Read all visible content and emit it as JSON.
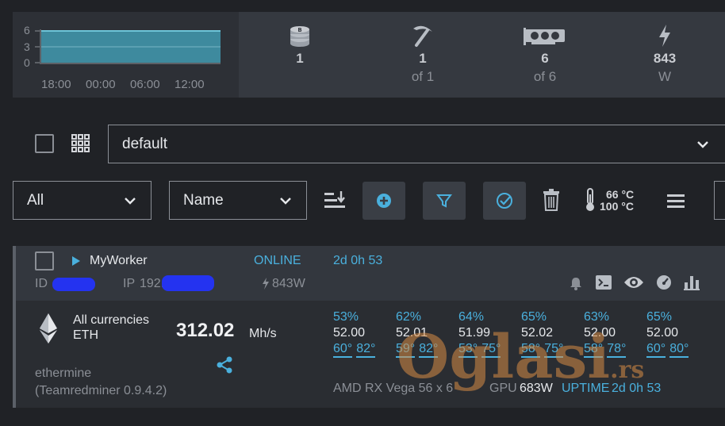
{
  "chart": {
    "y_ticks": [
      "6",
      "3",
      "0"
    ],
    "x_ticks": [
      "18:00",
      "00:00",
      "06:00",
      "12:00"
    ],
    "color": "#3e8a9e"
  },
  "chart_data": {
    "type": "area",
    "x": [
      "18:00",
      "00:00",
      "06:00",
      "12:00"
    ],
    "ylim": [
      0,
      6
    ],
    "series": [
      {
        "values": [
          6,
          6,
          6,
          6
        ]
      }
    ]
  },
  "stats": [
    {
      "icon": "coins-icon",
      "value": "1",
      "sub": ""
    },
    {
      "icon": "pickaxe-icon",
      "value": "1",
      "sub": "of 1"
    },
    {
      "icon": "gpu-icon",
      "value": "6",
      "sub": "of 6"
    },
    {
      "icon": "bolt-icon",
      "value": "843",
      "sub": "W"
    }
  ],
  "farm_select": {
    "value": "default"
  },
  "filter_select": {
    "value": "All"
  },
  "sort_select": {
    "value": "Name"
  },
  "temps": {
    "line1": "66 °C",
    "line2": "100 °C"
  },
  "worker": {
    "name": "MyWorker",
    "status": "ONLINE",
    "uptime_short": "2d 0h 53",
    "id_label": "ID",
    "ip_label": "IP",
    "ip_prefix": "192.",
    "power": "843W",
    "coin_name": "All currencies",
    "coin_symbol": "ETH",
    "hashrate": "312.02",
    "hashrate_unit": "Mh/s",
    "pool": "ethermine",
    "miner": "(Teamredminer 0.9.4.2)",
    "gpu_model": "AMD RX Vega 56 x 6",
    "gpu_label": "GPU",
    "gpu_power": "683W",
    "uptime_label": "UPTIME",
    "uptime": "2d 0h 53",
    "gpus": [
      {
        "fan": "53%",
        "hash": "52.00",
        "temp": "60°",
        "mem": "82°"
      },
      {
        "fan": "62%",
        "hash": "52.01",
        "temp": "59°",
        "mem": "82°"
      },
      {
        "fan": "64%",
        "hash": "51.99",
        "temp": "53°",
        "mem": "75°"
      },
      {
        "fan": "65%",
        "hash": "52.02",
        "temp": "58°",
        "mem": "75°"
      },
      {
        "fan": "63%",
        "hash": "52.00",
        "temp": "58°",
        "mem": "78°"
      },
      {
        "fan": "65%",
        "hash": "52.00",
        "temp": "60°",
        "mem": "80°"
      }
    ]
  },
  "watermark": {
    "brand": "Oglasi",
    "tld": ".rs"
  },
  "colors": {
    "accent": "#4ab0dd",
    "background": "#202226",
    "panel": "#353940"
  }
}
